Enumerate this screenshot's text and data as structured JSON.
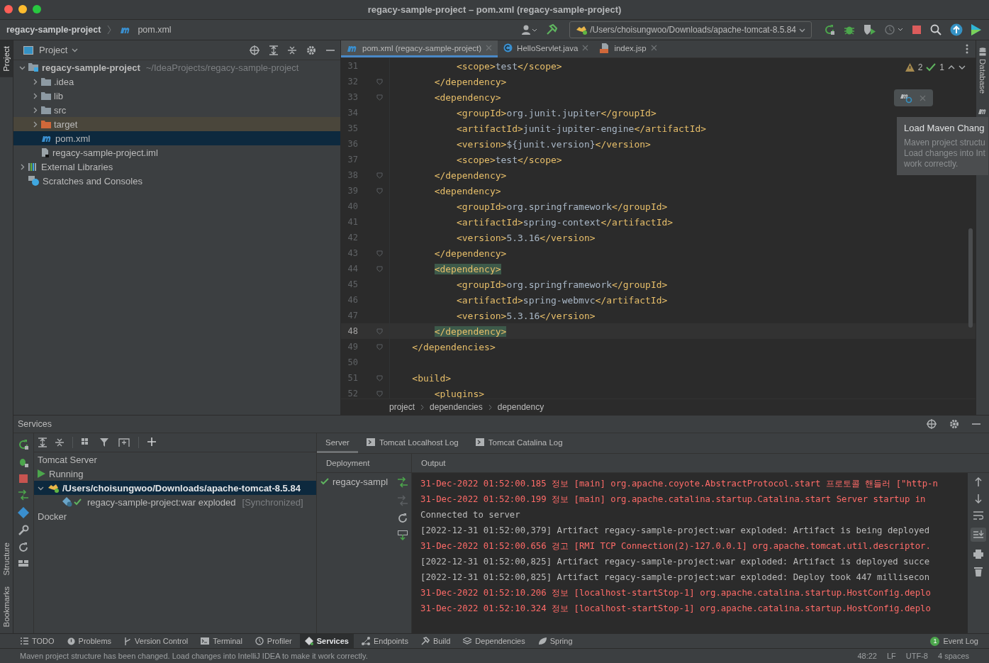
{
  "window": {
    "title": "regacy-sample-project – pom.xml (regacy-sample-project)"
  },
  "navbar": {
    "crumbs": [
      "regacy-sample-project",
      "pom.xml"
    ],
    "run_config": "/Users/choisungwoo/Downloads/apache-tomcat-8.5.84"
  },
  "left_stripe": [
    {
      "label": "Project",
      "selected": true
    },
    {
      "label": "Structure",
      "selected": false
    },
    {
      "label": "Bookmarks",
      "selected": false
    }
  ],
  "project": {
    "title": "Project",
    "tree": [
      {
        "label": "regacy-sample-project",
        "hint": "~/IdeaProjects/regacy-sample-project",
        "kind": "module",
        "expanded": true,
        "selected": false,
        "children": [
          {
            "label": ".idea",
            "kind": "folder",
            "expanded": false,
            "selected": false
          },
          {
            "label": "lib",
            "kind": "folder",
            "expanded": false,
            "selected": false
          },
          {
            "label": "src",
            "kind": "folder",
            "expanded": false,
            "selected": false
          },
          {
            "label": "target",
            "kind": "excluded",
            "expanded": false,
            "selected": false
          },
          {
            "label": "pom.xml",
            "kind": "maven",
            "selected": true
          },
          {
            "label": "regacy-sample-project.iml",
            "kind": "iml",
            "selected": false
          }
        ]
      },
      {
        "label": "External Libraries",
        "kind": "libraries",
        "expanded": false,
        "selected": false
      },
      {
        "label": "Scratches and Consoles",
        "kind": "scratches",
        "selected": false
      }
    ]
  },
  "editor": {
    "tabs": [
      {
        "label": "pom.xml (regacy-sample-project)",
        "kind": "maven",
        "selected": true
      },
      {
        "label": "HelloServlet.java",
        "kind": "java",
        "selected": false
      },
      {
        "label": "index.jsp",
        "kind": "jsp",
        "selected": false
      }
    ],
    "warnings": "2",
    "checks": "1",
    "lines": [
      {
        "number": "31",
        "text": "            <scope>test</scope>",
        "fold": false,
        "current": false,
        "matched": false
      },
      {
        "number": "32",
        "text": "        </dependency>",
        "fold": true,
        "current": false,
        "matched": false
      },
      {
        "number": "33",
        "text": "        <dependency>",
        "fold": true,
        "current": false,
        "matched": false
      },
      {
        "number": "34",
        "text": "            <groupId>org.junit.jupiter</groupId>",
        "fold": false,
        "current": false,
        "matched": false
      },
      {
        "number": "35",
        "text": "            <artifactId>junit-jupiter-engine</artifactId>",
        "fold": false,
        "current": false,
        "matched": false
      },
      {
        "number": "36",
        "text": "            <version>${junit.version}</version>",
        "fold": false,
        "current": false,
        "matched": false
      },
      {
        "number": "37",
        "text": "            <scope>test</scope>",
        "fold": false,
        "current": false,
        "matched": false
      },
      {
        "number": "38",
        "text": "        </dependency>",
        "fold": true,
        "current": false,
        "matched": false
      },
      {
        "number": "39",
        "text": "        <dependency>",
        "fold": true,
        "current": false,
        "matched": false
      },
      {
        "number": "40",
        "text": "            <groupId>org.springframework</groupId>",
        "fold": false,
        "current": false,
        "matched": false
      },
      {
        "number": "41",
        "text": "            <artifactId>spring-context</artifactId>",
        "fold": false,
        "current": false,
        "matched": false
      },
      {
        "number": "42",
        "text": "            <version>5.3.16</version>",
        "fold": false,
        "current": false,
        "matched": false
      },
      {
        "number": "43",
        "text": "        </dependency>",
        "fold": true,
        "current": false,
        "matched": false
      },
      {
        "number": "44",
        "text": "        <dependency>",
        "fold": true,
        "current": false,
        "matched": true
      },
      {
        "number": "45",
        "text": "            <groupId>org.springframework</groupId>",
        "fold": false,
        "current": false,
        "matched": false
      },
      {
        "number": "46",
        "text": "            <artifactId>spring-webmvc</artifactId>",
        "fold": false,
        "current": false,
        "matched": false
      },
      {
        "number": "47",
        "text": "            <version>5.3.16</version>",
        "fold": false,
        "current": false,
        "matched": false
      },
      {
        "number": "48",
        "text": "        </dependency>",
        "fold": true,
        "current": true,
        "matched": true
      },
      {
        "number": "49",
        "text": "    </dependencies>",
        "fold": true,
        "current": false,
        "matched": false
      },
      {
        "number": "50",
        "fold": false,
        "current": false
      },
      {
        "number": "51",
        "text": "    <build>",
        "fold": true,
        "current": false,
        "matched": false
      },
      {
        "number": "52",
        "text": "        <plugins>",
        "fold": true,
        "current": false,
        "matched": false
      }
    ],
    "breadcrumbs": [
      "project",
      "dependencies",
      "dependency"
    ],
    "popup": {
      "title": "Load Maven Chang",
      "lines": [
        "Maven project structu",
        "Load changes into Int",
        "work correctly."
      ]
    }
  },
  "right_stripe": [
    {
      "label": "Database"
    }
  ],
  "services": {
    "title": "Services",
    "tree": [
      {
        "label": "Tomcat Server",
        "kind": "group",
        "selected": false
      },
      {
        "label": "Running",
        "kind": "running",
        "selected": false
      },
      {
        "label": "/Users/choisungwoo/Downloads/apache-tomcat-8.5.84",
        "kind": "server",
        "expanded": true,
        "selected": true,
        "children": [
          {
            "label": "regacy-sample-project:war exploded",
            "status": "[Synchronized]",
            "kind": "artifact",
            "selected": false
          }
        ]
      },
      {
        "label": "Docker",
        "kind": "docker",
        "selected": false
      }
    ],
    "tabs": [
      {
        "label": "Server",
        "kind": "plain",
        "selected": true
      },
      {
        "label": "Tomcat Localhost Log",
        "kind": "log",
        "selected": false
      },
      {
        "label": "Tomcat Catalina Log",
        "kind": "log",
        "selected": false
      }
    ],
    "deployment_header": "Deployment",
    "output_header": "Output",
    "deployments": [
      {
        "label": "regacy-sampl"
      }
    ],
    "output": [
      {
        "text": "31-Dec-2022 01:52:00.185 정보 [main] org.apache.coyote.AbstractProtocol.start 프로토콜 핸들러 [\"http-n",
        "kind": "stderr"
      },
      {
        "text": "31-Dec-2022 01:52:00.199 정보 [main] org.apache.catalina.startup.Catalina.start Server startup in",
        "kind": "stderr"
      },
      {
        "text": "Connected to server",
        "kind": "stdout"
      },
      {
        "text": "[2022-12-31 01:52:00,379] Artifact regacy-sample-project:war exploded: Artifact is being deployed",
        "kind": "stdout"
      },
      {
        "text": "31-Dec-2022 01:52:00.656 경고 [RMI TCP Connection(2)-127.0.0.1] org.apache.tomcat.util.descriptor.",
        "kind": "stderr"
      },
      {
        "text": "[2022-12-31 01:52:00,825] Artifact regacy-sample-project:war exploded: Artifact is deployed succe",
        "kind": "stdout"
      },
      {
        "text": "[2022-12-31 01:52:00,825] Artifact regacy-sample-project:war exploded: Deploy took 447 millisecon",
        "kind": "stdout"
      },
      {
        "text": "31-Dec-2022 01:52:10.206 정보 [localhost-startStop-1] org.apache.catalina.startup.HostConfig.deplo",
        "kind": "stderr"
      },
      {
        "text": "31-Dec-2022 01:52:10.324 정보 [localhost-startStop-1] org.apache.catalina.startup.HostConfig.deplo",
        "kind": "stderr"
      }
    ]
  },
  "tool_windows": [
    {
      "label": "TODO",
      "kind": "todo",
      "selected": false
    },
    {
      "label": "Problems",
      "kind": "problems",
      "selected": false
    },
    {
      "label": "Version Control",
      "kind": "vcs",
      "selected": false
    },
    {
      "label": "Terminal",
      "kind": "terminal",
      "selected": false
    },
    {
      "label": "Profiler",
      "kind": "profiler",
      "selected": false
    },
    {
      "label": "Services",
      "kind": "services",
      "selected": true
    },
    {
      "label": "Endpoints",
      "kind": "endpoints",
      "selected": false
    },
    {
      "label": "Build",
      "kind": "build",
      "selected": false
    },
    {
      "label": "Dependencies",
      "kind": "dependencies",
      "selected": false
    },
    {
      "label": "Spring",
      "kind": "spring",
      "selected": false
    }
  ],
  "event_log": {
    "label": "Event Log",
    "count": "1"
  },
  "status_bar": {
    "message": "Maven project structure has been changed. Load changes into IntelliJ IDEA to make it work correctly.",
    "position": "48:22",
    "line_sep": "LF",
    "encoding": "UTF-8",
    "indent": "4 spaces"
  }
}
